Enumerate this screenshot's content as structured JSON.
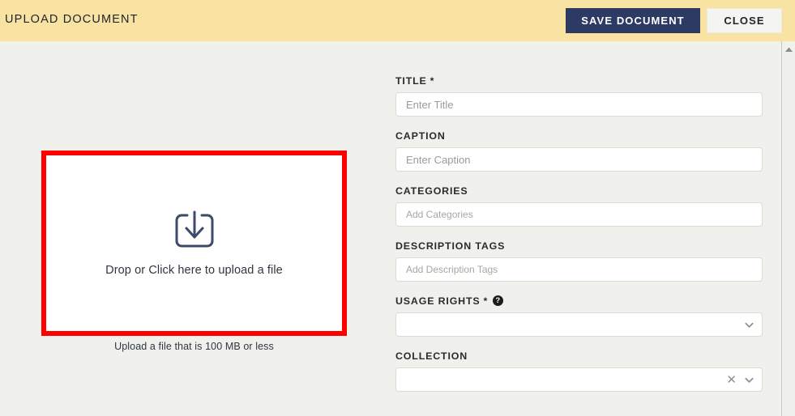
{
  "header": {
    "title": "UPLOAD DOCUMENT",
    "save_label": "SAVE DOCUMENT",
    "close_label": "CLOSE",
    "background_color": "#f9e3a2",
    "save_color": "#2c3a64"
  },
  "dropzone": {
    "icon": "download-tray-icon",
    "text": "Drop or Click here to upload a file",
    "hint": "Upload a file that is 100 MB or less",
    "border_color": "#fe0000"
  },
  "form": {
    "fields": [
      {
        "name": "title",
        "label": "TITLE",
        "required": true,
        "required_marker": "*",
        "placeholder": "Enter Title",
        "value": "",
        "type": "text"
      },
      {
        "name": "caption",
        "label": "CAPTION",
        "required": false,
        "required_marker": "",
        "placeholder": "Enter Caption",
        "value": "",
        "type": "text"
      },
      {
        "name": "categories",
        "label": "CATEGORIES",
        "required": false,
        "required_marker": "",
        "placeholder": "Add Categories",
        "value": "",
        "type": "tags"
      },
      {
        "name": "description_tags",
        "label": "DESCRIPTION TAGS",
        "required": false,
        "required_marker": "",
        "placeholder": "Add Description Tags",
        "value": "",
        "type": "tags"
      },
      {
        "name": "usage_rights",
        "label": "USAGE RIGHTS",
        "required": true,
        "required_marker": "*",
        "help_icon": "help-circle-icon",
        "placeholder": "",
        "value": "",
        "type": "select"
      },
      {
        "name": "collection",
        "label": "COLLECTION",
        "required": false,
        "required_marker": "",
        "placeholder": "",
        "value": "",
        "type": "select-clearable",
        "clear_icon": "close-x-icon",
        "chevron_icon": "chevron-down-icon"
      }
    ]
  },
  "scrollbar": {
    "up_icon": "scroll-up-arrow-icon"
  }
}
